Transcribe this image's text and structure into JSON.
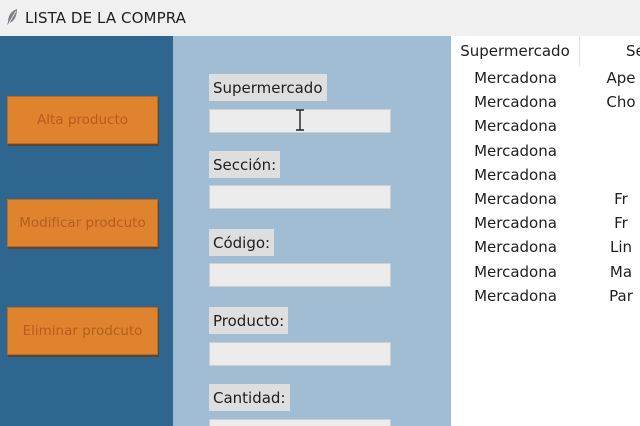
{
  "window": {
    "title": "LISTA DE LA COMPRA",
    "icon": "feather-icon"
  },
  "actions": {
    "add_label": "Alta producto",
    "modify_label": "Modificar prodcuto",
    "delete_label": "Eliminar prodcuto"
  },
  "form": {
    "supermercado_label": "Supermercado",
    "seccion_label": "Sección:",
    "codigo_label": "Código:",
    "producto_label": "Producto:",
    "cantidad_label": "Cantidad:",
    "supermercado_value": "",
    "seccion_value": "",
    "codigo_value": "",
    "producto_value": "",
    "cantidad_value": ""
  },
  "table": {
    "columns": [
      "Supermercado",
      "Se"
    ],
    "rows": [
      {
        "supermercado": "Mercadona",
        "seccion": "Ape"
      },
      {
        "supermercado": "Mercadona",
        "seccion": "Cho"
      },
      {
        "supermercado": "Mercadona",
        "seccion": ""
      },
      {
        "supermercado": "Mercadona",
        "seccion": ""
      },
      {
        "supermercado": "Mercadona",
        "seccion": ""
      },
      {
        "supermercado": "Mercadona",
        "seccion": "Fr"
      },
      {
        "supermercado": "Mercadona",
        "seccion": "Fr"
      },
      {
        "supermercado": "Mercadona",
        "seccion": "Lin"
      },
      {
        "supermercado": "Mercadona",
        "seccion": "Ma"
      },
      {
        "supermercado": "Mercadona",
        "seccion": "Par"
      }
    ]
  },
  "colors": {
    "left_panel": "#2f6690",
    "form_panel": "#a0bdd3",
    "button": "#e0832f",
    "button_text": "#b35d1e"
  }
}
